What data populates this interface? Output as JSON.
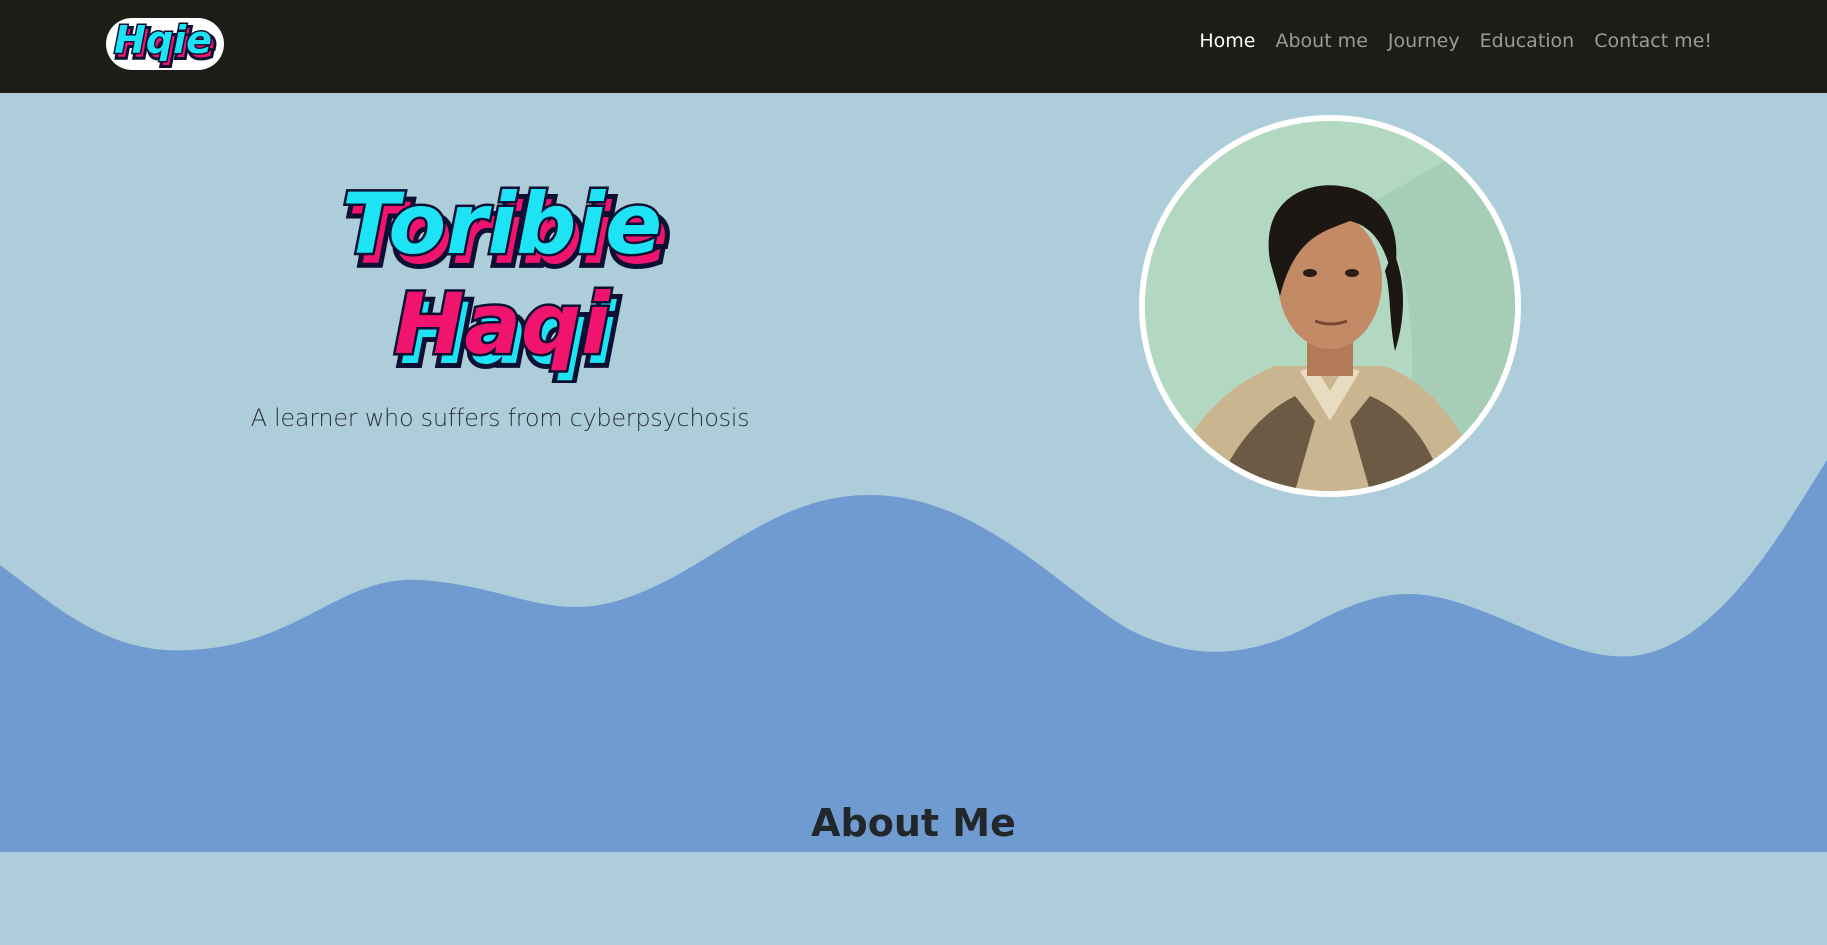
{
  "navbar": {
    "brand_text": "Hqie",
    "links": [
      {
        "label": "Home",
        "active": true
      },
      {
        "label": "About me",
        "active": false
      },
      {
        "label": "Journey",
        "active": false
      },
      {
        "label": "Education",
        "active": false
      },
      {
        "label": "Contact me!",
        "active": false
      }
    ]
  },
  "hero": {
    "name_first": "Toribie",
    "name_last": "Haqi",
    "tagline": "A learner who suffers from cyberpsychosis",
    "avatar_icon": "profile-photo"
  },
  "about": {
    "title": "About Me"
  },
  "colors": {
    "navbar_bg": "#1b1d16",
    "hero_bg": "#adcdda",
    "wave": "#709bd0",
    "cyan": "#1ee3f5",
    "pink": "#f0146e",
    "outline": "#0d1033"
  }
}
